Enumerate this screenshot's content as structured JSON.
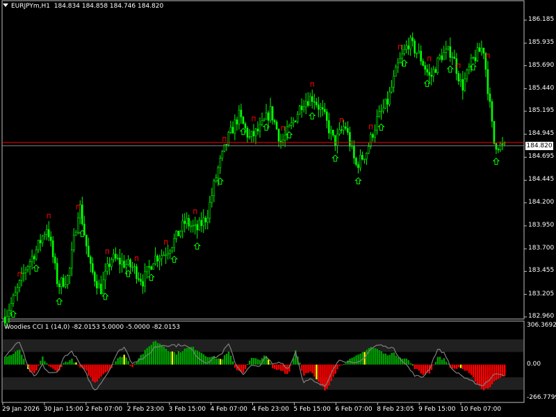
{
  "colors": {
    "background": "#000000",
    "frame": "#c0c0c0",
    "bull_candle": "#00ff00",
    "bear_candle": "#00ff00",
    "ask_line": "#ff0000",
    "bid_line": "#808080",
    "fractal_up": "#ff0000",
    "fractal_down": "#00ff00",
    "cci_positive": "#00a000",
    "cci_negative": "#ff0000",
    "cci_neutral": "#ffff00",
    "cci_line": "#808080",
    "cci_zone": "#202020"
  },
  "chart_header": {
    "menu_icon": "triangle-down-icon",
    "symbol": "EURJPYm,H1",
    "ohlc": "184.834 184.858 184.746 184.820"
  },
  "price_axis": {
    "labels": [
      "186.185",
      "185.935",
      "185.690",
      "185.440",
      "185.195",
      "184.945",
      "184.695",
      "184.445",
      "184.200",
      "183.950",
      "183.700",
      "183.455",
      "183.205",
      "182.960"
    ],
    "current_price": "184.820"
  },
  "indicator": {
    "title": "Woodies CCI 1 (14,0) -82.0153 5.0000 -5.0000 -82.0153",
    "axis_labels": [
      "306.3692",
      "0.00",
      "-266.7799"
    ]
  },
  "time_axis": {
    "labels": [
      "29 Jan 2026",
      "30 Jan 15:00",
      "2 Feb 07:00",
      "2 Feb 23:00",
      "3 Feb 15:00",
      "4 Feb 07:00",
      "4 Feb 23:00",
      "5 Feb 15:00",
      "6 Feb 07:00",
      "8 Feb 23:05",
      "9 Feb 15:00",
      "10 Feb 07:00"
    ]
  },
  "chart_data": {
    "type": "candlestick",
    "symbol": "EURJPYm",
    "timeframe": "H1",
    "ylim": [
      182.96,
      186.185
    ],
    "close_path": [
      182.96,
      183.2,
      183.5,
      183.7,
      183.95,
      183.3,
      183.4,
      184.2,
      183.5,
      183.25,
      183.6,
      183.55,
      183.5,
      183.35,
      183.6,
      183.65,
      183.8,
      184.0,
      183.9,
      184.05,
      184.55,
      184.9,
      185.15,
      184.9,
      185.0,
      185.2,
      184.85,
      185.05,
      185.3,
      185.35,
      185.15,
      184.85,
      185.05,
      184.6,
      184.75,
      185.1,
      185.3,
      185.7,
      185.95,
      185.8,
      185.55,
      185.8,
      185.85,
      185.45,
      185.75,
      185.9,
      184.85,
      184.8
    ],
    "current_price": 184.82,
    "ask_price": 184.856,
    "fractal_up_count": 17,
    "fractal_down_count": 23,
    "indicator": {
      "name": "Woodies CCI",
      "params": "(14,0)",
      "value": -82.0153,
      "levels": [
        5.0,
        -5.0
      ],
      "ylim": [
        -266.7799,
        306.3692
      ],
      "trend_cci": [
        60,
        80,
        120,
        -40,
        -80,
        60,
        -20,
        -60,
        20,
        40,
        -20,
        -60,
        -150,
        -80,
        -40,
        40,
        80,
        -20,
        60,
        120,
        190,
        160,
        110,
        90,
        120,
        140,
        110,
        70,
        60,
        40,
        100,
        -40,
        -60,
        50,
        40,
        70,
        -40,
        -40,
        -80,
        120,
        -80,
        -60,
        -140,
        -210,
        -90,
        0,
        30,
        60,
        100,
        140,
        120,
        80,
        90,
        60,
        40,
        -30,
        -80,
        -60,
        60,
        40,
        -40,
        -20,
        -60,
        -120,
        -200,
        -180,
        -110,
        -80
      ]
    }
  }
}
